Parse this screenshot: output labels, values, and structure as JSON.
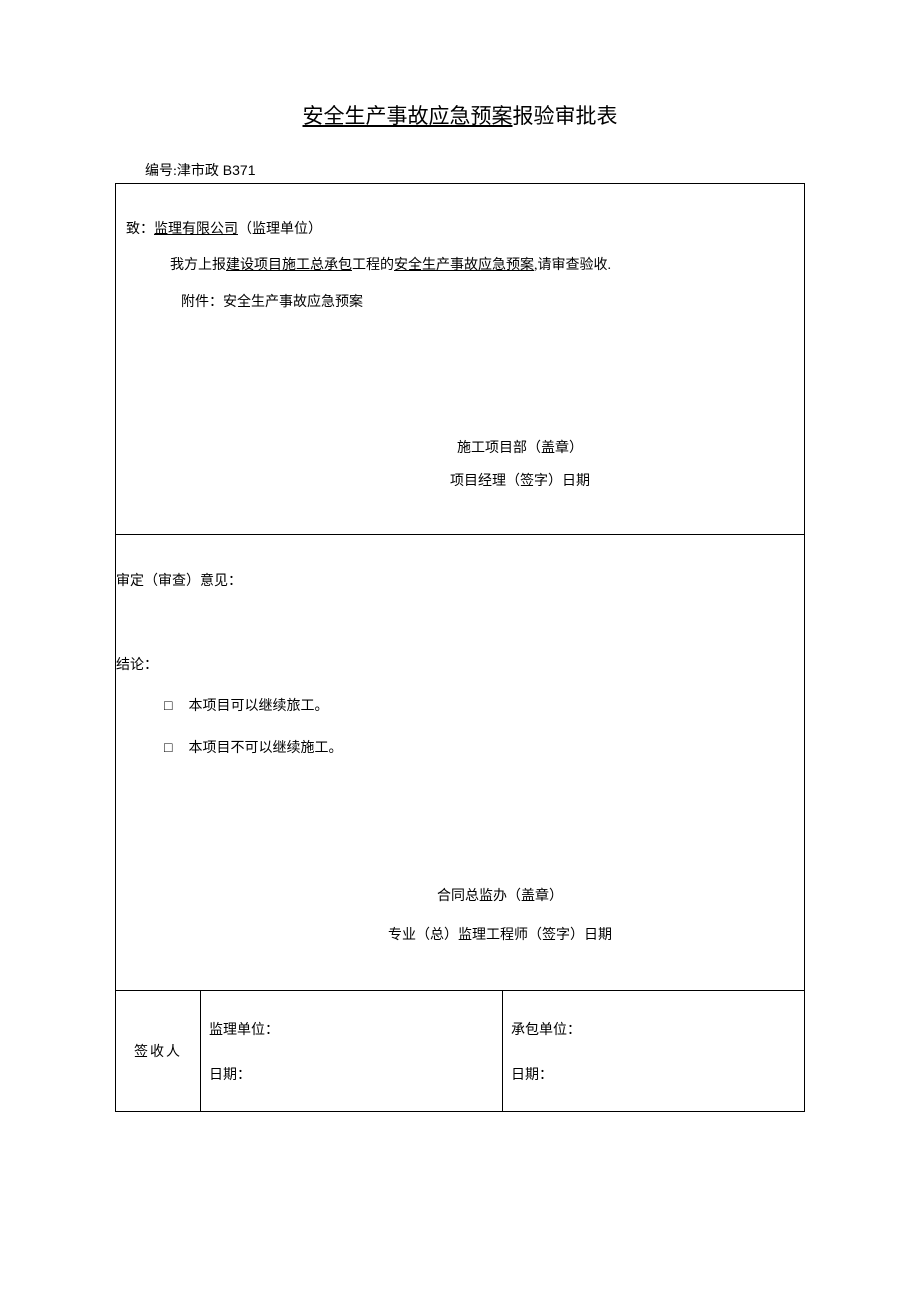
{
  "title": {
    "underlined": "安全生产事故应急预案",
    "rest": "报验审批表"
  },
  "doc_no": {
    "prefix": "编号:",
    "value_cn": "津市政",
    "value_num": " B371"
  },
  "section1": {
    "to_prefix": "致：",
    "to_underlined": "监理有限公司",
    "to_suffix": "（监理单位）",
    "body_prefix": "我方上报",
    "body_u1": "建设项目施工总承包",
    "body_mid": "工程的",
    "body_u2": "安全生产事故应急预案",
    "body_suffix": ",请审查验收.",
    "attach": "附件：安全生产事故应急预案",
    "sig_line1": "施工项目部（盖章）",
    "sig_line2": "项目经理（签字）日期"
  },
  "section2": {
    "review_label": "审定（审查）意见：",
    "conclusion_label": "结论：",
    "checkbox_symbol": "□",
    "option1": "本项目可以继续旅工。",
    "option2": "本项目不可以继续施工。",
    "sig_line1": "合同总监办（盖章）",
    "sig_line2": "专业（总）监理工程师（签字）日期"
  },
  "section3": {
    "label": "签收人",
    "left_unit": "监理单位：",
    "left_date": "日期：",
    "right_unit": "承包单位：",
    "right_date": "日期："
  }
}
